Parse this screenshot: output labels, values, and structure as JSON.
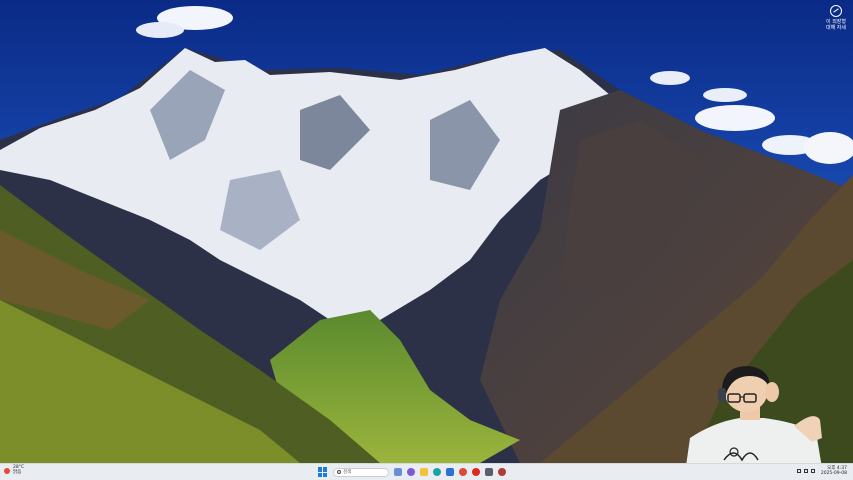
{
  "desktop": {
    "shortcut": {
      "icon": "recycle-icon",
      "line1": "이 외장형",
      "line2": "대해 자세"
    }
  },
  "taskbar": {
    "weather": {
      "temp": "28°C",
      "cond": "맑음",
      "icon": "sun-icon"
    },
    "search": {
      "placeholder": "검색"
    },
    "apps": [
      {
        "name": "widgets-icon",
        "color": "#6b8fd6"
      },
      {
        "name": "copilot-icon",
        "color": "#7c5cd6"
      },
      {
        "name": "file-explorer-icon",
        "color": "#f2c23a"
      },
      {
        "name": "edge-icon",
        "color": "#1aa3a3"
      },
      {
        "name": "store-icon",
        "color": "#2f6fd8"
      },
      {
        "name": "chrome-icon",
        "color": "#d94b3a"
      },
      {
        "name": "youtube-icon",
        "color": "#e0281e"
      },
      {
        "name": "settings-icon",
        "color": "#5a5f6b"
      },
      {
        "name": "app-icon",
        "color": "#b23a3a"
      }
    ],
    "clock": {
      "time": "오후 4:37",
      "date": "2025-09-08"
    }
  }
}
